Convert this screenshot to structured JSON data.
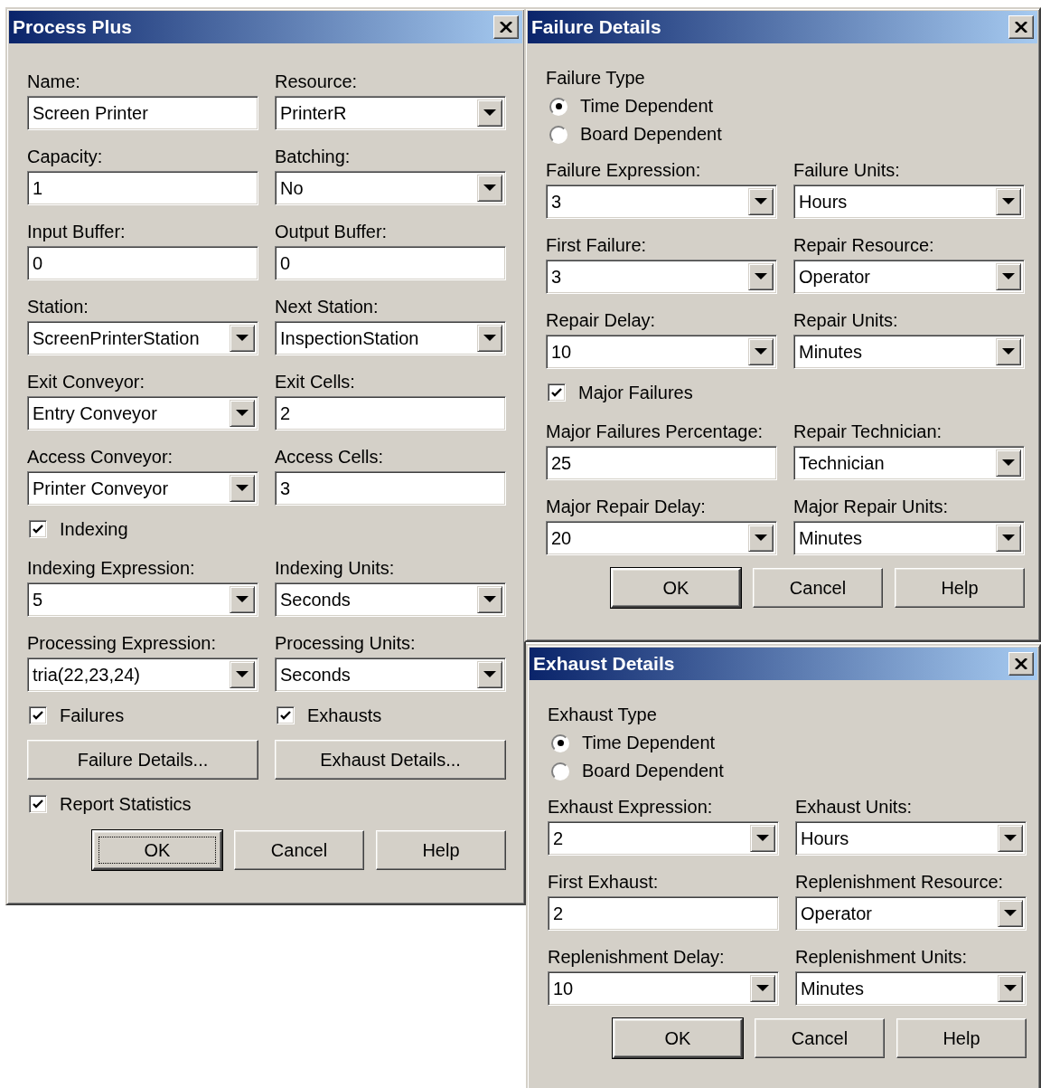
{
  "windows": [
    {
      "title": "Process Plus",
      "rows": [
        [
          {
            "kind": "text_field",
            "label": "Name:",
            "value": "Screen Printer"
          },
          {
            "kind": "combo",
            "label": "Resource:",
            "value": "PrinterR"
          }
        ],
        [
          {
            "kind": "text_field",
            "label": "Capacity:",
            "value": "1"
          },
          {
            "kind": "combo",
            "label": "Batching:",
            "value": "No"
          }
        ],
        [
          {
            "kind": "text_field",
            "label": "Input Buffer:",
            "value": "0"
          },
          {
            "kind": "text_field",
            "label": "Output Buffer:",
            "value": "0"
          }
        ],
        [
          {
            "kind": "combo",
            "label": "Station:",
            "value": "ScreenPrinterStation"
          },
          {
            "kind": "combo",
            "label": "Next Station:",
            "value": "InspectionStation"
          }
        ],
        [
          {
            "kind": "combo",
            "label": "Exit Conveyor:",
            "value": "Entry Conveyor"
          },
          {
            "kind": "text_field",
            "label": "Exit Cells:",
            "value": "2"
          }
        ],
        [
          {
            "kind": "combo",
            "label": "Access Conveyor:",
            "value": "Printer Conveyor"
          },
          {
            "kind": "text_field",
            "label": "Access Cells:",
            "value": "3"
          }
        ],
        [
          {
            "kind": "checkbox",
            "label": "Indexing",
            "checked": true
          }
        ],
        [
          {
            "kind": "combo",
            "label": "Indexing Expression:",
            "value": "5"
          },
          {
            "kind": "combo",
            "label": "Indexing Units:",
            "value": "Seconds"
          }
        ],
        [
          {
            "kind": "combo",
            "label": "Processing Expression:",
            "value": "tria(22,23,24)"
          },
          {
            "kind": "combo",
            "label": "Processing Units:",
            "value": "Seconds"
          }
        ],
        [
          {
            "kind": "checkbox",
            "label": "Failures",
            "checked": true
          },
          {
            "kind": "checkbox",
            "label": "Exhausts",
            "checked": true
          }
        ],
        [
          {
            "kind": "button",
            "label": "Failure Details..."
          },
          {
            "kind": "button",
            "label": "Exhaust Details..."
          }
        ],
        [
          {
            "kind": "checkbox",
            "label": "Report Statistics",
            "checked": true
          }
        ]
      ],
      "buttons": [
        {
          "label": "OK",
          "default": true,
          "focused": true
        },
        {
          "label": "Cancel",
          "default": false,
          "focused": false
        },
        {
          "label": "Help",
          "default": false,
          "focused": false
        }
      ]
    },
    {
      "title": "Failure Details",
      "rows": [
        [
          {
            "kind": "radios",
            "label": "Failure Type",
            "options": [
              {
                "label": "Time Dependent",
                "selected": true
              },
              {
                "label": "Board Dependent",
                "selected": false
              }
            ]
          }
        ],
        [
          {
            "kind": "combo",
            "label": "Failure Expression:",
            "value": "3"
          },
          {
            "kind": "combo",
            "label": "Failure Units:",
            "value": "Hours"
          }
        ],
        [
          {
            "kind": "combo",
            "label": "First Failure:",
            "value": "3"
          },
          {
            "kind": "combo",
            "label": "Repair Resource:",
            "value": "Operator"
          }
        ],
        [
          {
            "kind": "combo",
            "label": "Repair Delay:",
            "value": "10"
          },
          {
            "kind": "combo",
            "label": "Repair Units:",
            "value": "Minutes"
          }
        ],
        [
          {
            "kind": "checkbox",
            "label": "Major Failures",
            "checked": true
          }
        ],
        [
          {
            "kind": "text_field",
            "label": "Major Failures Percentage:",
            "value": "25"
          },
          {
            "kind": "combo",
            "label": "Repair Technician:",
            "value": "Technician"
          }
        ],
        [
          {
            "kind": "combo",
            "label": "Major Repair Delay:",
            "value": "20"
          },
          {
            "kind": "combo",
            "label": "Major Repair Units:",
            "value": "Minutes"
          }
        ]
      ],
      "buttons": [
        {
          "label": "OK",
          "default": true,
          "focused": false
        },
        {
          "label": "Cancel",
          "default": false,
          "focused": false
        },
        {
          "label": "Help",
          "default": false,
          "focused": false
        }
      ]
    },
    {
      "title": "Exhaust Details",
      "rows": [
        [
          {
            "kind": "radios",
            "label": "Exhaust Type",
            "options": [
              {
                "label": "Time Dependent",
                "selected": true
              },
              {
                "label": "Board Dependent",
                "selected": false
              }
            ]
          }
        ],
        [
          {
            "kind": "combo",
            "label": "Exhaust Expression:",
            "value": "2"
          },
          {
            "kind": "combo",
            "label": "Exhaust Units:",
            "value": "Hours"
          }
        ],
        [
          {
            "kind": "text_field",
            "label": "First Exhaust:",
            "value": "2"
          },
          {
            "kind": "combo",
            "label": "Replenishment Resource:",
            "value": "Operator"
          }
        ],
        [
          {
            "kind": "combo",
            "label": "Replenishment Delay:",
            "value": "10"
          },
          {
            "kind": "combo",
            "label": "Replenishment Units:",
            "value": "Minutes"
          }
        ]
      ],
      "buttons": [
        {
          "label": "OK",
          "default": true,
          "focused": false
        },
        {
          "label": "Cancel",
          "default": false,
          "focused": false
        },
        {
          "label": "Help",
          "default": false,
          "focused": false
        }
      ]
    }
  ]
}
